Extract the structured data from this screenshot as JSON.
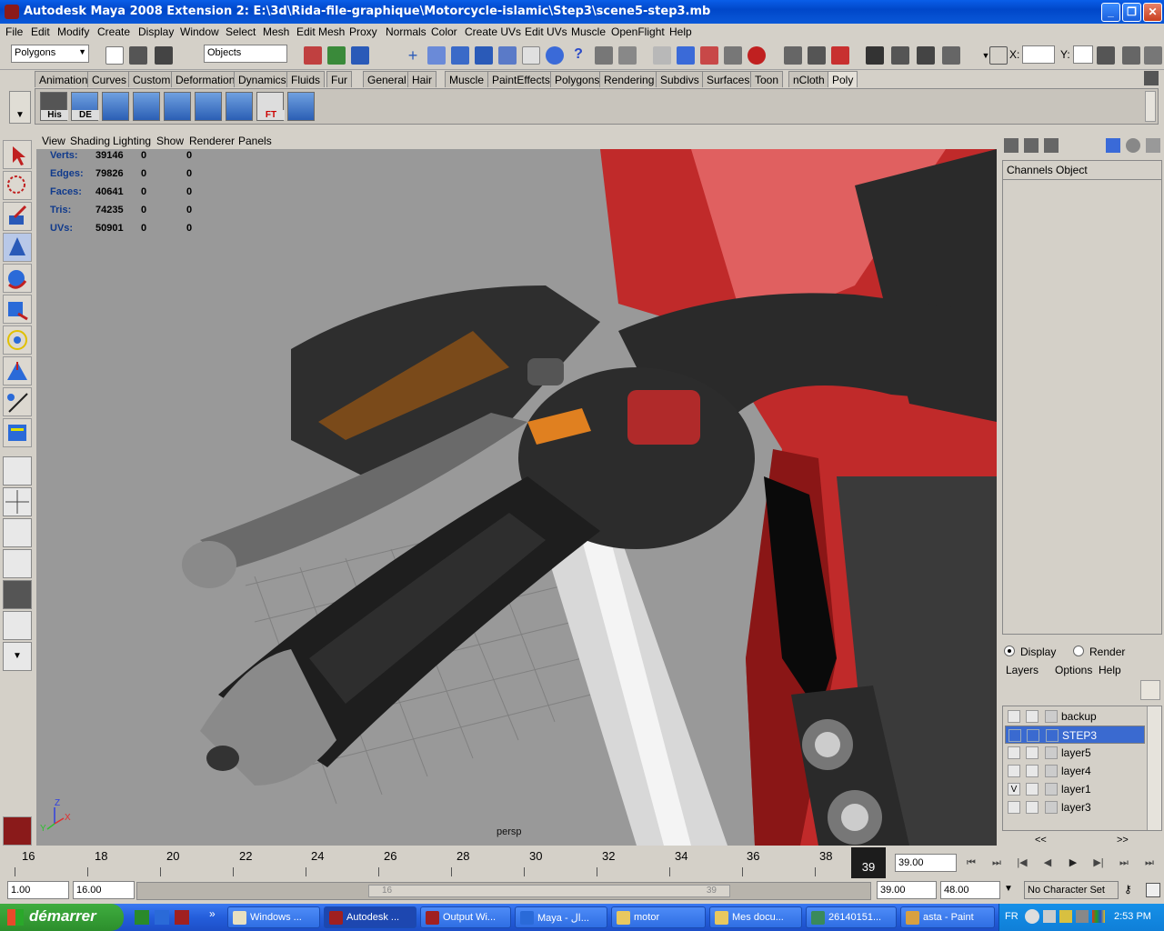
{
  "window": {
    "title": "Autodesk Maya 2008 Extension 2: E:\\3d\\Rida-file-graphique\\Motorcycle-islamic\\Step3\\scene5-step3.mb"
  },
  "menubar": [
    "File",
    "Edit",
    "Modify",
    "Create",
    "Display",
    "Window",
    "Select",
    "Mesh",
    "Edit Mesh",
    "Proxy",
    "Normals",
    "Color",
    "Create UVs",
    "Edit UVs",
    "Muscle",
    "OpenFlight",
    "Help"
  ],
  "toolbar": {
    "mode_select": "Polygons",
    "selection_field": "Objects",
    "x_label": "X:",
    "y_label": "Y:"
  },
  "shelf_tabs": [
    "Animation",
    "Curves",
    "Custom",
    "Deformation",
    "Dynamics",
    "Fluids",
    "Fur",
    "General",
    "Hair",
    "Muscle",
    "PaintEffects",
    "Polygons",
    "Rendering",
    "Subdivs",
    "Surfaces",
    "Toon",
    "nCloth",
    "Poly"
  ],
  "shelf_tab_active": "Poly",
  "shelf_buttons": [
    "His",
    "DE",
    "",
    "",
    "",
    "",
    "",
    "FT",
    ""
  ],
  "viewport_menu": [
    "View",
    "Shading",
    "Lighting",
    "Show",
    "Renderer",
    "Panels"
  ],
  "hud": [
    {
      "label": "Verts:",
      "a": "39146",
      "b": "0",
      "c": "0"
    },
    {
      "label": "Edges:",
      "a": "79826",
      "b": "0",
      "c": "0"
    },
    {
      "label": "Faces:",
      "a": "40641",
      "b": "0",
      "c": "0"
    },
    {
      "label": "Tris:",
      "a": "74235",
      "b": "0",
      "c": "0"
    },
    {
      "label": "UVs:",
      "a": "50901",
      "b": "0",
      "c": "0"
    }
  ],
  "camera_label": "persp",
  "axis": {
    "z": "Z",
    "x": "X",
    "y": "Y"
  },
  "channelbox": {
    "menu1": "Channels",
    "menu2": "Object"
  },
  "layer_editor": {
    "display": "Display",
    "render": "Render",
    "menu": [
      "Layers",
      "Options",
      "Help"
    ],
    "layers": [
      {
        "name": "backup",
        "v": ""
      },
      {
        "name": "STEP3",
        "v": ""
      },
      {
        "name": "layer5",
        "v": ""
      },
      {
        "name": "layer4",
        "v": ""
      },
      {
        "name": "layer1",
        "v": "V"
      },
      {
        "name": "layer3",
        "v": ""
      }
    ],
    "selected": "STEP3",
    "scroll_left": "<<",
    "scroll_right": ">>"
  },
  "timeline": {
    "ticks": [
      "16",
      "18",
      "20",
      "22",
      "24",
      "26",
      "28",
      "30",
      "32",
      "34",
      "36",
      "38"
    ],
    "current_frame": "39",
    "current_field": "39.00"
  },
  "range": {
    "start": "1.00",
    "range_start": "16.00",
    "slider_start": "16",
    "slider_end": "39",
    "range_end": "39.00",
    "end": "48.00",
    "char_set": "No Character Set"
  },
  "taskbar": {
    "start": "démarrer",
    "tasks": [
      "Windows ...",
      "Autodesk ...",
      "Output Wi...",
      "Maya - ال...",
      "motor",
      "Mes docu...",
      "26140151...",
      "asta - Paint"
    ],
    "lang": "FR",
    "clock": "2:53 PM"
  }
}
